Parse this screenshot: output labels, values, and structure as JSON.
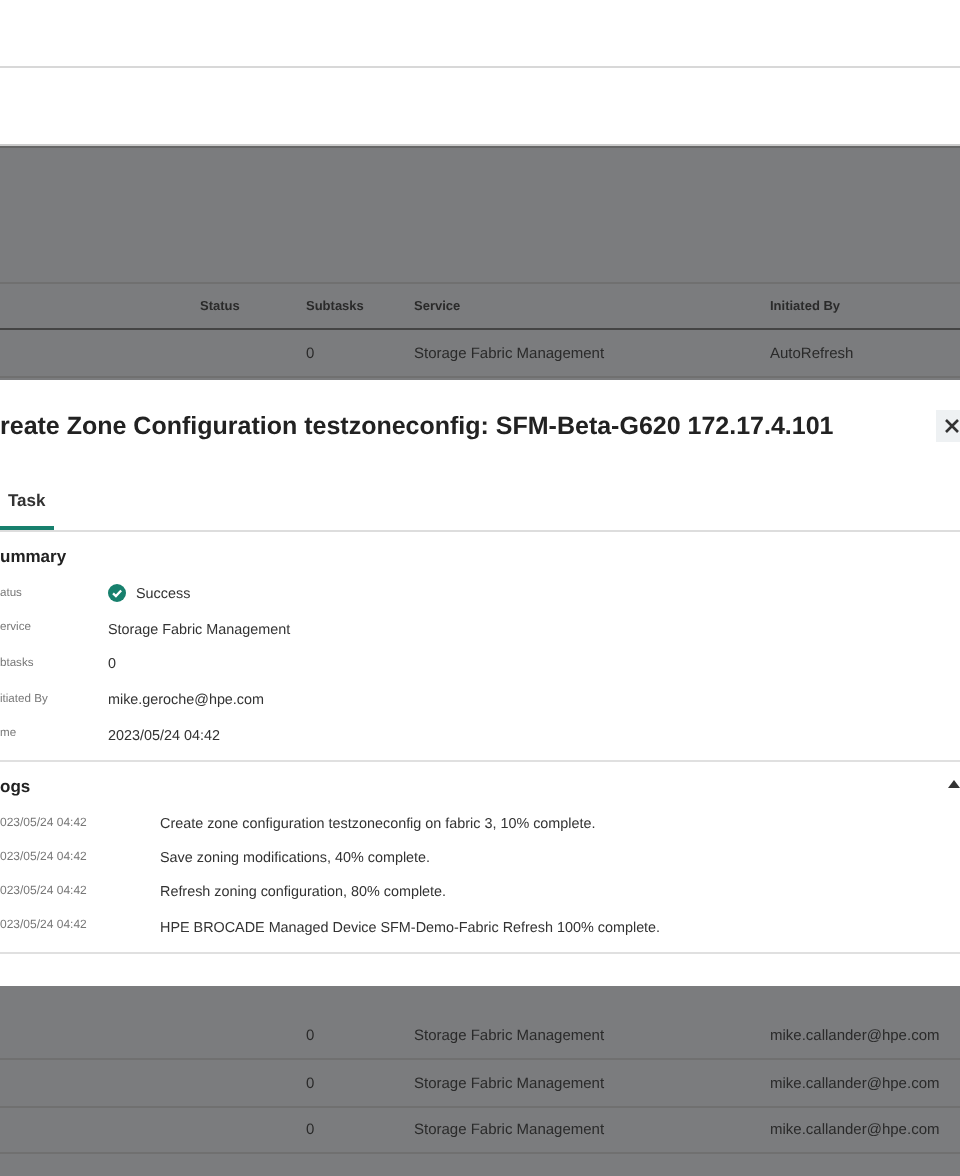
{
  "background_table": {
    "columns": [
      "Status",
      "Subtasks",
      "Service",
      "Initiated By"
    ],
    "rows_above": [
      {
        "subtasks": "0",
        "service": "Storage Fabric Management",
        "initiated_by": "AutoRefresh"
      }
    ],
    "rows_below": [
      {
        "subtasks": "0",
        "service": "Storage Fabric Management",
        "initiated_by": "mike.callander@hpe.com"
      },
      {
        "subtasks": "0",
        "service": "Storage Fabric Management",
        "initiated_by": "mike.callander@hpe.com"
      },
      {
        "subtasks": "0",
        "service": "Storage Fabric Management",
        "initiated_by": "mike.callander@hpe.com"
      }
    ]
  },
  "dialog": {
    "title": "reate Zone Configuration testzoneconfig: SFM-Beta-G620 172.17.4.101",
    "tabs": [
      {
        "label": "Task",
        "selected": true
      }
    ],
    "summary": {
      "heading": "ummary",
      "fields": [
        {
          "kind": "status",
          "label": "atus",
          "value": "Success"
        },
        {
          "kind": "text",
          "label": "ervice",
          "value": "Storage Fabric Management"
        },
        {
          "kind": "text",
          "label": "btasks",
          "value": "0"
        },
        {
          "kind": "text",
          "label": "itiated By",
          "value": "mike.geroche@hpe.com"
        },
        {
          "kind": "text",
          "label": "me",
          "value": "2023/05/24 04:42"
        }
      ]
    },
    "logs": {
      "heading": "ogs",
      "expanded": true,
      "entries": [
        {
          "time": "023/05/24 04:42",
          "message": "Create zone configuration testzoneconfig on fabric 3, 10% complete."
        },
        {
          "time": "023/05/24 04:42",
          "message": "Save zoning modifications, 40% complete."
        },
        {
          "time": "023/05/24 04:42",
          "message": "Refresh zoning configuration, 80% complete."
        },
        {
          "time": "023/05/24 04:42",
          "message": "HPE BROCADE Managed Device SFM-Demo-Fabric Refresh 100% complete."
        }
      ]
    }
  }
}
